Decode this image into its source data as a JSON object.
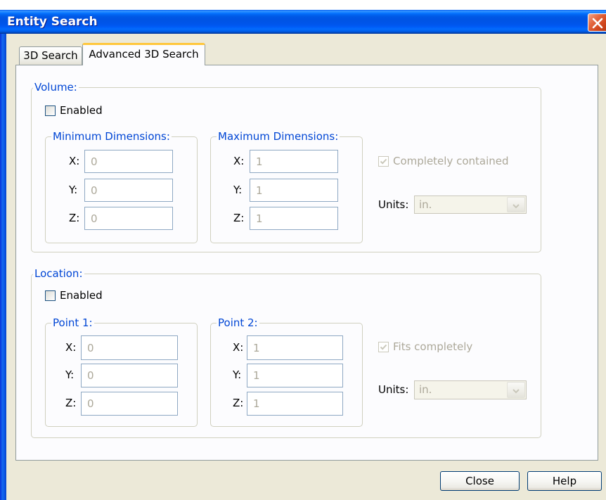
{
  "window": {
    "title": "Entity Search",
    "close_icon": "close-icon"
  },
  "tabs": [
    {
      "label": "3D Search",
      "selected": false
    },
    {
      "label": "Advanced 3D Search",
      "selected": true
    }
  ],
  "volume": {
    "title": "Volume:",
    "enabled": {
      "label": "Enabled",
      "checked": false
    },
    "minimum": {
      "title": "Minimum Dimensions:",
      "fields": [
        {
          "label": "X:",
          "value": "0"
        },
        {
          "label": "Y:",
          "value": "0"
        },
        {
          "label": "Z:",
          "value": "0"
        }
      ]
    },
    "maximum": {
      "title": "Maximum Dimensions:",
      "fields": [
        {
          "label": "X:",
          "value": "1"
        },
        {
          "label": "Y:",
          "value": "1"
        },
        {
          "label": "Z:",
          "value": "1"
        }
      ]
    },
    "completely_contained": {
      "label": "Completely contained",
      "checked": true,
      "disabled": true
    },
    "units": {
      "label": "Units:",
      "value": "in.",
      "disabled": true,
      "icon": "chevron-down-icon"
    }
  },
  "location": {
    "title": "Location:",
    "enabled": {
      "label": "Enabled",
      "checked": false
    },
    "point1": {
      "title": "Point 1:",
      "fields": [
        {
          "label": "X:",
          "value": "0"
        },
        {
          "label": "Y:",
          "value": "0"
        },
        {
          "label": "Z:",
          "value": "0"
        }
      ]
    },
    "point2": {
      "title": "Point 2:",
      "fields": [
        {
          "label": "X:",
          "value": "1"
        },
        {
          "label": "Y:",
          "value": "1"
        },
        {
          "label": "Z:",
          "value": "1"
        }
      ]
    },
    "fits_completely": {
      "label": "Fits completely",
      "checked": true,
      "disabled": true
    },
    "units": {
      "label": "Units:",
      "value": "in.",
      "disabled": true,
      "icon": "chevron-down-icon"
    }
  },
  "buttons": {
    "close": "Close",
    "help": "Help"
  },
  "colors": {
    "title_bar": "#0054E3",
    "group_title": "#0046D5",
    "disabled_text": "#ACA899",
    "close_button": "#D2471D",
    "selected_tab_accent": "#FFC73C"
  }
}
